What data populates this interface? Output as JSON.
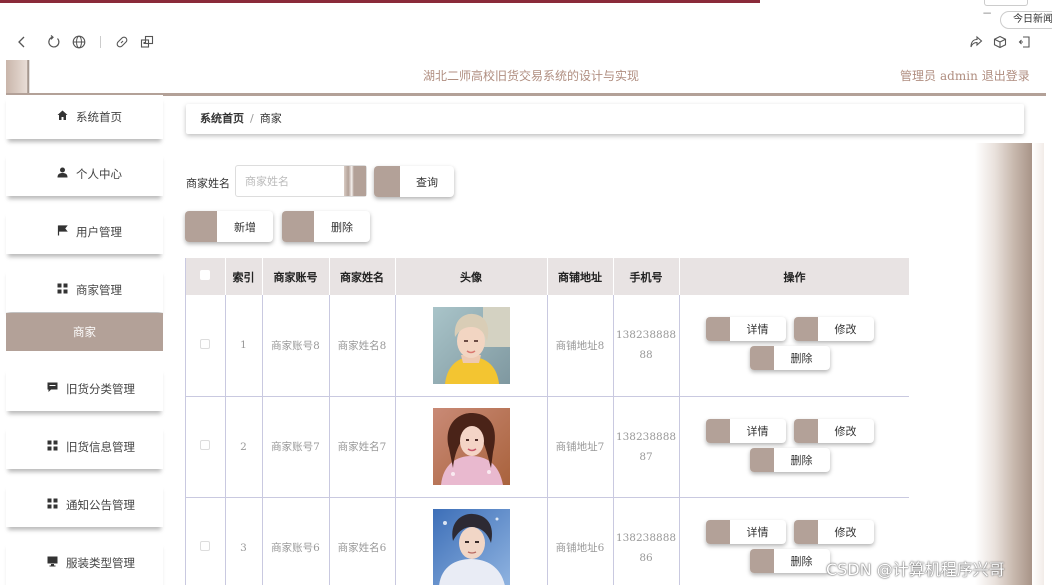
{
  "browser": {
    "today_tab": "今日新闻",
    "minimize": "−",
    "icons": [
      "back-icon",
      "reload-icon",
      "globe-icon",
      "link-icon",
      "qr-icon",
      "share-icon",
      "cube-icon",
      "exit-icon"
    ]
  },
  "header": {
    "title": "湖北二师高校旧货交易系统的设计与实现",
    "role": "管理员",
    "user": "admin",
    "logout": "退出登录"
  },
  "sidebar": {
    "items": [
      {
        "label": "系统首页",
        "icon": "home-icon"
      },
      {
        "label": "个人中心",
        "icon": "user-icon"
      },
      {
        "label": "用户管理",
        "icon": "flag-icon"
      },
      {
        "label": "商家管理",
        "icon": "grid-icon"
      },
      {
        "label": "商家",
        "icon": ""
      },
      {
        "label": "旧货分类管理",
        "icon": "message-icon"
      },
      {
        "label": "旧货信息管理",
        "icon": "grid-icon"
      },
      {
        "label": "通知公告管理",
        "icon": "grid-icon"
      },
      {
        "label": "服装类型管理",
        "icon": "monitor-icon"
      }
    ]
  },
  "breadcrumb": {
    "home": "系统首页",
    "sep": "/",
    "current": "商家"
  },
  "search": {
    "label": "商家姓名",
    "placeholder": "商家姓名",
    "query_button": "查询"
  },
  "actions": {
    "add": "新增",
    "delete": "删除"
  },
  "table": {
    "headers": [
      "",
      "索引",
      "商家账号",
      "商家姓名",
      "头像",
      "商铺地址",
      "手机号",
      "操作"
    ],
    "rows": [
      {
        "index": "1",
        "account": "商家账号8",
        "name": "商家姓名8",
        "address": "商铺地址8",
        "phone_a": "138238888",
        "phone_b": "88"
      },
      {
        "index": "2",
        "account": "商家账号7",
        "name": "商家姓名7",
        "address": "商铺地址7",
        "phone_a": "138238888",
        "phone_b": "87"
      },
      {
        "index": "3",
        "account": "商家账号6",
        "name": "商家姓名6",
        "address": "商铺地址6",
        "phone_a": "138238888",
        "phone_b": "86"
      }
    ],
    "ops": {
      "detail": "详情",
      "edit": "修改",
      "delete": "删除"
    }
  },
  "watermark": "CSDN @计算机程序兴哥",
  "colors": {
    "accent": "#b3a198",
    "title": "#b08e80",
    "topline": "#8a2a3a"
  }
}
